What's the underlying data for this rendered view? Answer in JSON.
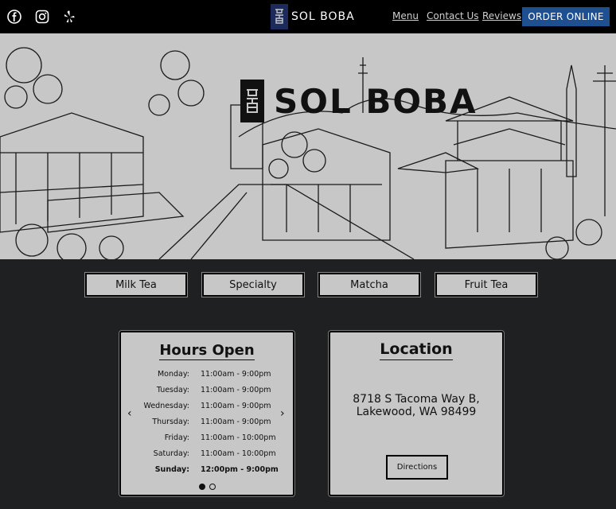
{
  "header": {
    "brand_text": "SOL BOBA",
    "nav": {
      "menu": "Menu",
      "contact": "Contact Us",
      "reviews": "Reviews"
    },
    "order_button": "ORDER ONLINE",
    "social_icons": [
      "facebook-icon",
      "instagram-icon",
      "yelp-icon"
    ]
  },
  "hero": {
    "title": "SOL BOBA"
  },
  "categories": [
    "Milk Tea",
    "Specialty",
    "Matcha",
    "Fruit Tea"
  ],
  "hours": {
    "title": "Hours Open",
    "rows": [
      {
        "day": "Monday:",
        "time": "11:00am - 9:00pm"
      },
      {
        "day": "Tuesday:",
        "time": "11:00am - 9:00pm"
      },
      {
        "day": "Wednesday:",
        "time": "11:00am - 9:00pm"
      },
      {
        "day": "Thursday:",
        "time": "11:00am - 9:00pm"
      },
      {
        "day": "Friday:",
        "time": "11:00am - 10:00pm"
      },
      {
        "day": "Saturday:",
        "time": "11:00am - 10:00pm"
      },
      {
        "day": "Sunday:",
        "time": "12:00pm - 9:00pm"
      }
    ],
    "prev_arrow": "‹",
    "next_arrow": "›"
  },
  "location": {
    "title": "Location",
    "address_line1": "8718 S Tacoma Way B,",
    "address_line2": "Lakewood, WA 98499",
    "directions_button": "Directions"
  },
  "colors": {
    "topbar": "#000000",
    "page_bg": "#1f2021",
    "panel_bg": "#c7c7c7",
    "order_button": "#1d4f91",
    "brand_mark": "#1d2a5c"
  }
}
